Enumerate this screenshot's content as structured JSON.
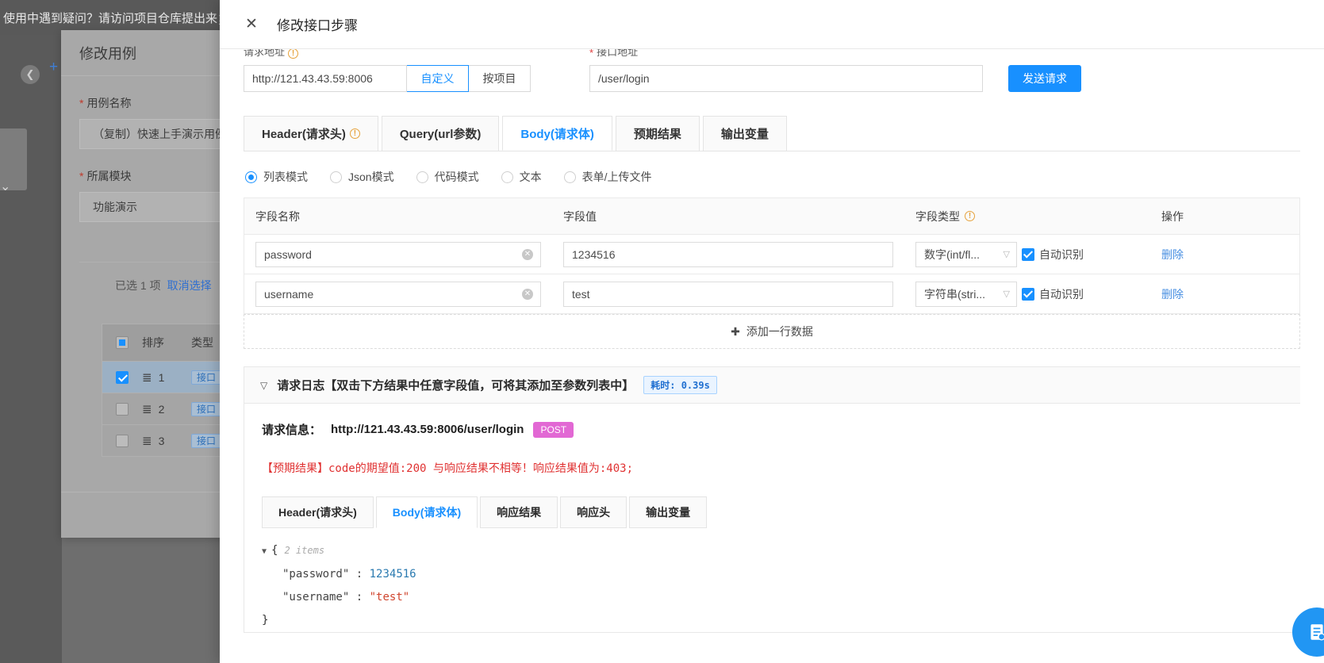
{
  "background": {
    "topbar_text": "使用中遇到疑问？请访问项目仓库提出来；",
    "modal": {
      "title": "修改用例",
      "fields": [
        {
          "label": "用例名称",
          "required_mark": "*",
          "value": "（复制）快速上手演示用例"
        },
        {
          "label": "所属模块",
          "required_mark": "*",
          "value": "功能演示"
        }
      ],
      "selection_text": "已选 1 项",
      "cancel_selection_label": "取消选择",
      "table": {
        "headers": [
          "",
          "排序",
          "类型"
        ],
        "rows": [
          {
            "checked": true,
            "order": "1",
            "type": "接口"
          },
          {
            "checked": false,
            "order": "2",
            "type": "接口"
          },
          {
            "checked": false,
            "order": "3",
            "type": "接口"
          }
        ]
      }
    }
  },
  "drawer": {
    "title": "修改接口步骤",
    "close_icon": "close-icon",
    "url_section": {
      "host_label": "请求地址",
      "host_label_icon": "warning-circle-icon",
      "host_value": "http://121.43.43.59:8006",
      "mode_custom": "自定义",
      "mode_project": "按项目",
      "path_label": "接口地址",
      "path_required_mark": "*",
      "path_value": "/user/login",
      "send_button": "发送请求"
    },
    "tabs": [
      {
        "label": "Header(请求头)",
        "icon": "warning-circle-icon",
        "active": false
      },
      {
        "label": "Query(url参数)",
        "icon": "",
        "active": false
      },
      {
        "label": "Body(请求体)",
        "icon": "",
        "active": true
      },
      {
        "label": "预期结果",
        "icon": "",
        "active": false
      },
      {
        "label": "输出变量",
        "icon": "",
        "active": false
      }
    ],
    "body_modes": [
      {
        "label": "列表模式",
        "selected": true
      },
      {
        "label": "Json模式",
        "selected": false
      },
      {
        "label": "代码模式",
        "selected": false
      },
      {
        "label": "文本",
        "selected": false
      },
      {
        "label": "表单/上传文件",
        "selected": false
      }
    ],
    "param_table": {
      "headers": {
        "name": "字段名称",
        "value": "字段值",
        "type": "字段类型",
        "type_icon": "warning-circle-icon",
        "action": "操作"
      },
      "rows": [
        {
          "name": "password",
          "value": "1234516",
          "type": "数字(int/fl...",
          "auto_detect_label": "自动识别",
          "auto_detect_checked": true,
          "delete_label": "删除"
        },
        {
          "name": "username",
          "value": "test",
          "type": "字符串(stri...",
          "auto_detect_label": "自动识别",
          "auto_detect_checked": true,
          "delete_label": "删除"
        }
      ],
      "add_row_label": "添加一行数据",
      "add_row_icon": "plus-icon"
    },
    "log": {
      "header_title": "请求日志【双击下方结果中任意字段值，可将其添加至参数列表中】",
      "collapse_icon": "chevron-down-icon",
      "duration_badge": "耗时: 0.39s",
      "request_info_label": "请求信息：",
      "request_url": "http://121.43.43.59:8006/user/login",
      "method": "POST",
      "error_text": "【预期结果】code的期望值:200 与响应结果不相等！响应结果值为:403;",
      "subtabs": [
        {
          "label": "Header(请求头)",
          "active": false
        },
        {
          "label": "Body(请求体)",
          "active": true
        },
        {
          "label": "响应结果",
          "active": false
        },
        {
          "label": "响应头",
          "active": false
        },
        {
          "label": "输出变量",
          "active": false
        }
      ],
      "json": {
        "open_brace": "{",
        "items_hint": "2 items",
        "entries": [
          {
            "key": "\"password\"",
            "sep": ":",
            "value": "1234516",
            "kind": "number"
          },
          {
            "key": "\"username\"",
            "sep": ":",
            "value": "\"test\"",
            "kind": "string"
          }
        ],
        "close_brace": "}"
      }
    },
    "fab_icon": "document-icon"
  },
  "colors": {
    "accent": "#1890ff",
    "error": "#e03131",
    "method_badge": "#e268d4",
    "link": "#4a90e2"
  }
}
